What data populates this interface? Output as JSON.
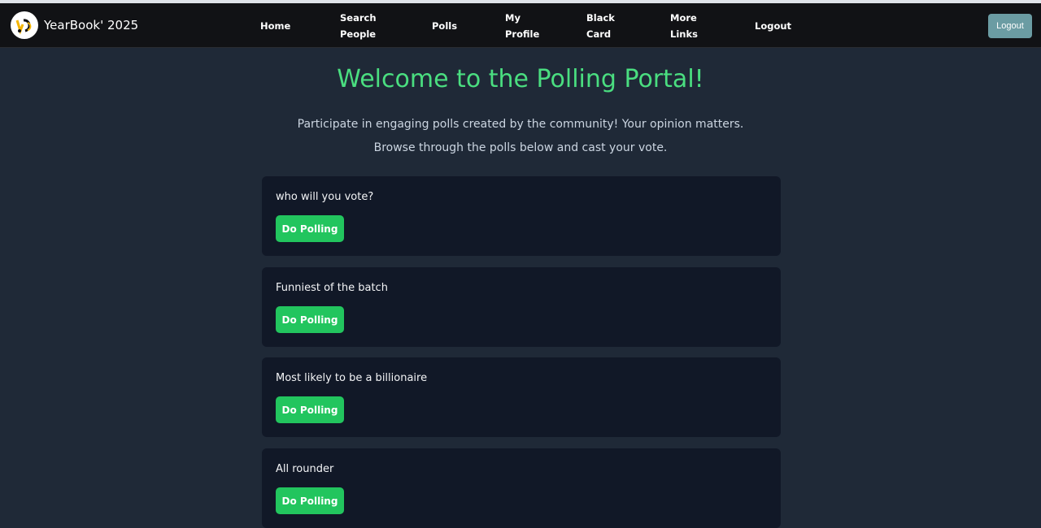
{
  "brand": {
    "name": "YearBook' 2025",
    "logo_icon": "yearbook-logo-icon"
  },
  "nav": {
    "home": [
      "Home"
    ],
    "search": [
      "Search",
      "People"
    ],
    "polls": [
      "Polls"
    ],
    "profile": [
      "My",
      "Profile"
    ],
    "black_card": [
      "Black",
      "Card"
    ],
    "more_links": [
      "More",
      "Links"
    ],
    "logout": [
      "Logout"
    ]
  },
  "logout_button": "Logout",
  "hero": {
    "title": "Welcome to the Polling Portal!",
    "line1": "Participate in engaging polls created by the community! Your opinion matters.",
    "line2": "Browse through the polls below and cast your vote."
  },
  "polls": [
    {
      "question": "who will you vote?",
      "button": "Do Polling"
    },
    {
      "question": "Funniest of the batch",
      "button": "Do Polling"
    },
    {
      "question": "Most likely to be a billionaire",
      "button": "Do Polling"
    },
    {
      "question": "All rounder",
      "button": "Do Polling"
    }
  ],
  "colors": {
    "accent": "#4ade80",
    "button": "#22c55e",
    "navbar": "#111215",
    "background": "#1f2937",
    "card": "#111827",
    "logout": "#6b9ca3"
  }
}
